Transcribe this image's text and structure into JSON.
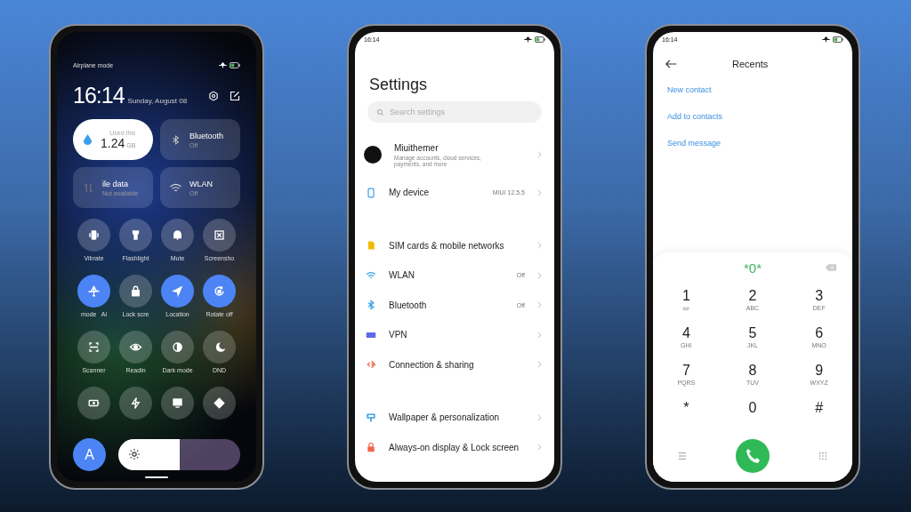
{
  "control_center": {
    "status_label": "Airplane mode",
    "time": "16:14",
    "date": "Sunday, August 08",
    "tiles": [
      {
        "kind": "data",
        "caption": "Used this",
        "value": "1.24",
        "unit": "GB"
      },
      {
        "kind": "switch",
        "title": "Bluetooth",
        "status": "Off",
        "on": false
      },
      {
        "kind": "switch",
        "title": "ile data",
        "status": "Not available",
        "on": false
      },
      {
        "kind": "switch",
        "title": "WLAN",
        "status": "Off",
        "on": false
      }
    ],
    "toggles": [
      {
        "label": "Vibrate",
        "on": false
      },
      {
        "label": "Flashlight",
        "on": false
      },
      {
        "label": "Mute",
        "on": false
      },
      {
        "label": "Screensho",
        "on": false
      },
      {
        "label": "mode   Ai",
        "on": true
      },
      {
        "label": "Lock scre",
        "on": false
      },
      {
        "label": "Location",
        "on": true
      },
      {
        "label": "Rotate off",
        "on": true
      },
      {
        "label": "Scanner",
        "on": false
      },
      {
        "label": "Readin",
        "on": false
      },
      {
        "label": "Dark mode",
        "on": false
      },
      {
        "label": "DND",
        "on": false
      },
      {
        "on": false
      },
      {
        "on": false
      },
      {
        "on": false
      },
      {
        "on": false
      }
    ],
    "auto_brightness": {
      "label": "A",
      "on": true
    },
    "brightness": {
      "level": 0.5
    }
  },
  "settings": {
    "status_time": "16:14",
    "title": "Settings",
    "search": {
      "placeholder": "Search settings"
    },
    "groups": [
      [
        {
          "title": "Miuithemer",
          "subtitle": "Manage accounts, cloud services, payments, and more"
        },
        {
          "title": "My device",
          "value": "MIUI 12.5.5"
        }
      ],
      [
        {
          "title": "SIM cards & mobile networks"
        },
        {
          "title": "WLAN",
          "value": "Off"
        },
        {
          "title": "Bluetooth",
          "value": "Off"
        },
        {
          "title": "VPN"
        },
        {
          "title": "Connection & sharing"
        }
      ],
      [
        {
          "title": "Wallpaper & personalization"
        },
        {
          "title": "Always-on display & Lock screen"
        }
      ]
    ]
  },
  "dialer": {
    "status_time": "16:14",
    "title": "Recents",
    "actions": [
      "New contact",
      "Add to contacts",
      "Send message"
    ],
    "number": "*0*",
    "keys": [
      {
        "digit": "1"
      },
      {
        "digit": "2",
        "letters": "ABC"
      },
      {
        "digit": "3",
        "letters": "DEF"
      },
      {
        "digit": "4",
        "letters": "GHI"
      },
      {
        "digit": "5",
        "letters": "JKL"
      },
      {
        "digit": "6",
        "letters": "MNO"
      },
      {
        "digit": "7",
        "letters": "PQRS"
      },
      {
        "digit": "8",
        "letters": "TUV"
      },
      {
        "digit": "9",
        "letters": "WXYZ"
      },
      {
        "digit": "*"
      },
      {
        "digit": "0"
      },
      {
        "digit": "#"
      }
    ]
  }
}
